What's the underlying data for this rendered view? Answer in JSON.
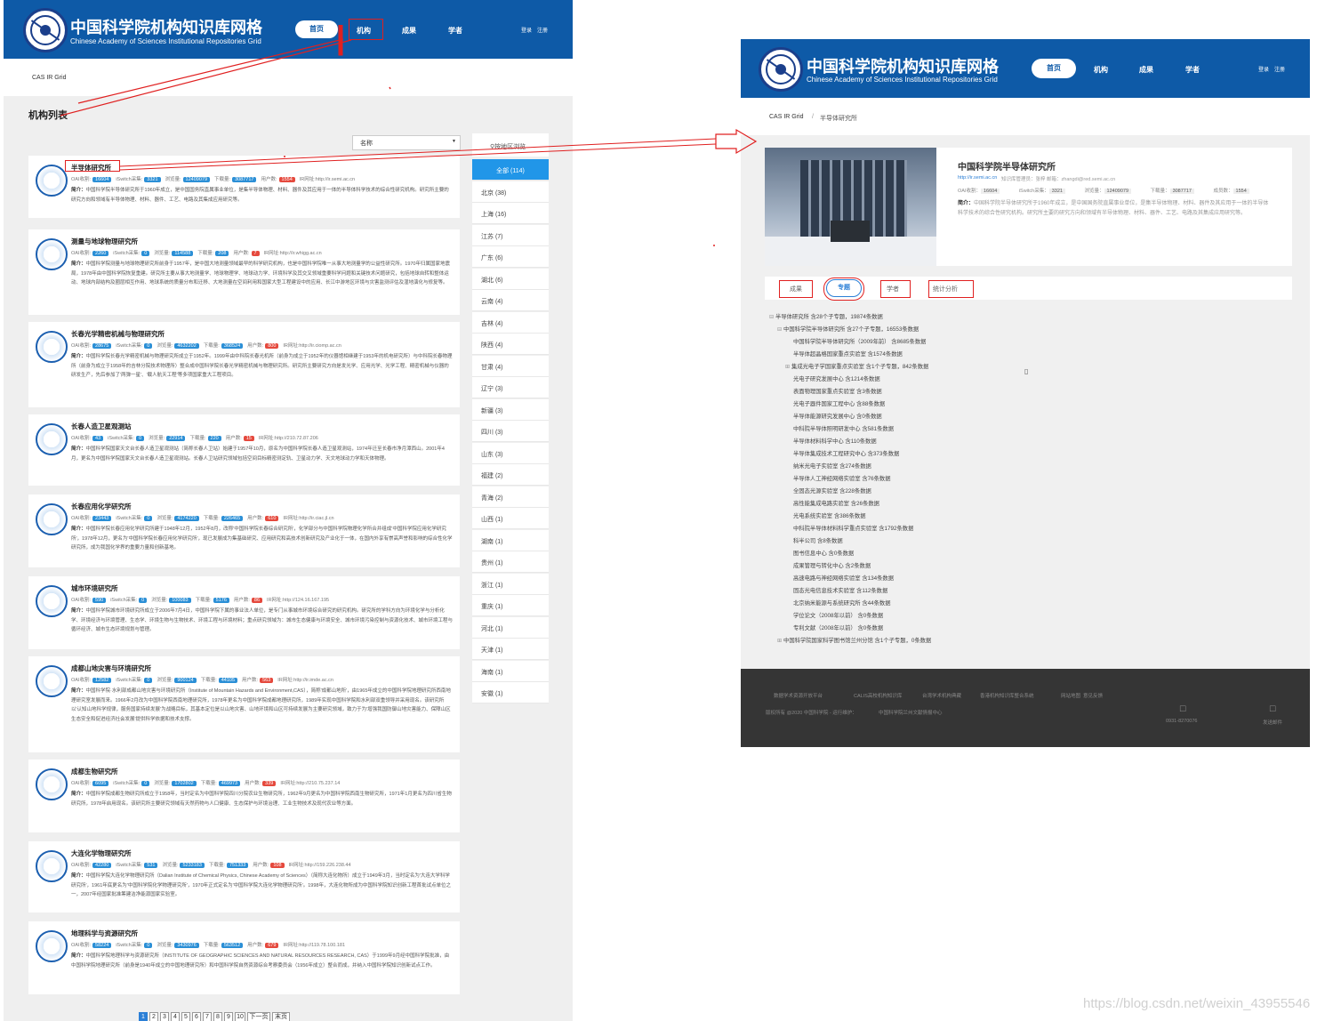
{
  "left": {
    "header": {
      "title": "中国科学院机构知识库网格",
      "subtitle": "Chinese Academy of Sciences Institutional Repositories Grid",
      "nav": [
        "首页",
        "机构",
        "成果",
        "学者"
      ],
      "login": "登录",
      "register": "注册"
    },
    "breadcrumb": "CAS IR Grid",
    "list_title": "机构列表",
    "sort_select": "名称",
    "region_title": "按地区浏览",
    "regions": [
      "全部 (114)",
      "北京 (38)",
      "上海 (16)",
      "江苏 (7)",
      "广东 (6)",
      "湖北 (6)",
      "云南 (4)",
      "吉林 (4)",
      "陕西 (4)",
      "甘肃 (4)",
      "辽宁 (3)",
      "新疆 (3)",
      "四川 (3)",
      "山东 (3)",
      "福建 (2)",
      "青海 (2)",
      "山西 (1)",
      "湖南 (1)",
      "贵州 (1)",
      "浙江 (1)",
      "重庆 (1)",
      "河北 (1)",
      "天津 (1)",
      "海南 (1)",
      "安徽 (1)"
    ],
    "stat_labels": {
      "oai": "OAI收割:",
      "iswitch": "iSwitch采集:",
      "views": "浏览量:",
      "downloads": "下载量:",
      "users": "用户数:",
      "url": "IR网址:",
      "intro": "简介："
    },
    "institutes": [
      {
        "name": "半导体研究所",
        "oai": "16604",
        "iswitch": "3321",
        "views": "12409079",
        "downloads": "3087717",
        "users": "1554",
        "url": "http://ir.semi.ac.cn",
        "intro": "中国科学院半导体研究所于1960年成立，是中国国务院直属事业单位，是集半导体物理、材料、器件及其应用于一体的半导体科学技术的综合性研究机构。研究所主要的研究方向和领域有半导体物理、材料、器件、工艺、电路及其集成应用研究等。"
      },
      {
        "name": "测量与地球物理研究所",
        "oai": "2260",
        "iswitch": "0",
        "views": "114588",
        "downloads": "208",
        "users": "7",
        "url": "http://ir.whigg.ac.cn",
        "intro": "中国科学院测量与地球物理研究所前身于1957年，是中国大地测量领域最早的科学研究机构，也是中国科学院唯一从事大地测量学的公益性研究所。1970年归属国家地震局，1978年由中国科学院恢复重建。研究所主要从事大地测量学、地球物理学、地球动力学、环境科学及其交叉领域重要科学问题和关键技术问题研究，包括地球自转和整体运动、地球内部结构及圈层相互作用、地球系统的质量分布和迁移、大地测量在空间利用和国家大型工程建设中的应用、长江中游地区环境与灾害监测评估及湿地演化与修复等。"
      },
      {
        "name": "长春光学精密机械与物理研究所",
        "oai": "28675",
        "iswitch": "0",
        "views": "4632202",
        "downloads": "368524",
        "users": "800",
        "url": "http://ir.ciomp.ac.cn",
        "intro": "中国科学院长春光学精密机械与物理研究所成立于1952年。1999年由中科院长春光机所（前身为成立于1952年的仪器馆相继建于1953年的机电研究所）与中科院长春物理所（前身为成立于1958年的吉林分院技术物理所）整合成中国科学院长春光学精密机械与物理研究所。研究所主要研究方向是发光学、应用光学、光学工程、精密机械与仪器的研发生产，先后参加了'两弹一星'、'载人航天工程'等多项国家重大工程项目。"
      },
      {
        "name": "长春人造卫星观测站",
        "oai": "43",
        "iswitch": "0",
        "views": "22914",
        "downloads": "220",
        "users": "15",
        "url": "http://210.72.87.206",
        "intro": "中国科学院国家天文台长春人造卫星观测站（简称长春人卫站）始建于1957年10月，原名为中国科学院长春人造卫星观测站，1974年迁至长春市净月潭西山。2001年4月，更名为中国科学院国家天文台长春人造卫星观测站。长春人卫站研究领域包括空间目标精密测定轨、卫星动力学、天文地球动力学和天体物理。"
      },
      {
        "name": "长春应用化学研究所",
        "oai": "23443",
        "iswitch": "0",
        "views": "4174220",
        "downloads": "226465",
        "users": "610",
        "url": "http://ir.ciac.jl.cn",
        "intro": "中国科学院长春应用化学研究所建于1948年12月，1952年8月，改称'中国科学院长春综合研究所'，化学部分与中国科学院物理化学所合并组成'中国科学院应用化学研究所'，1978年12月，更名为'中国科学院长春应用化学研究所'，现已发展成为集基础研究、应用研究和高技术创新研究及产业化于一体，在国内外享有崇高声誉和影响的综合性化学研究所，成为我国化学界的重要力量和创新基地。"
      },
      {
        "name": "城市环境研究所",
        "oai": "590",
        "iswitch": "0",
        "views": "100083",
        "downloads": "5176",
        "users": "86",
        "url": "http://124.16.167.195",
        "intro": "中国科学院城市环境研究所成立于2006年7月4日，中国科学院下属的事业法人单位，是专门从事城市环境综合研究的研究机构。研究所的学科方向为环境化学与分析化学、环境经济与环境管理、生态学、环境生物与生物技术、环境工程与环境材料；重点研究领域为：城市生态健康与环境安全、城市环境污染控制与资源化技术、城市环境工程与循环经济、城市生态环境规划与管理。"
      },
      {
        "name": "成都山地灾害与环境研究所",
        "oai": "12582",
        "iswitch": "0",
        "views": "900124",
        "downloads": "44105",
        "users": "563",
        "url": "http://ir.imde.ac.cn",
        "intro": "中国科学院·水利部成都山地灾害与环境研究所（Institute of Mountain Hazards and Environment,CAS），简称'成都山地所'，由1965年成立的中国科学院地理研究所西南地理研究室发展而来。1966年2月改为中国科学院西南地理研究所，1978年更名为中国科学院成都地理研究所，1989年实现中国科学院和水利部双重领导并采用现名。该研究所以'认知山地科学规律，服务国家持续发展'为战略目标，其基本定位是以山地灾害、山地环境和山区可持续发展为主要研究领域，致力于为'增强我国防御山地灾害能力、保障山区生态安全和促进经济社会发展'提供科学依据和技术支撑。"
      },
      {
        "name": "成都生物研究所",
        "oai": "6095",
        "iswitch": "0",
        "views": "1702802",
        "downloads": "469973",
        "users": "339",
        "url": "http://210.75.237.14",
        "intro": "中国科学院成都生物研究所成立于1958年，当时定名为中国科学院四川分院农业生物研究所，1962年9月更名为中国科学院西南生物研究所，1971年1月更名为四川省生物研究所，1978年启用现名。该研究所主要研究领域有天然药物与人口健康、生态保护与环境治理、工业生物技术及现代农业等方面。"
      },
      {
        "name": "大连化学物理研究所",
        "oai": "42280",
        "iswitch": "531",
        "views": "5233183",
        "downloads": "751333",
        "users": "108",
        "url": "http://159.226.238.44",
        "intro": "中国科学院大连化学物理研究所（Dalian Institute of Chemical Physics, Chinese Academy of Sciences）（简称大连化物所）成立于1949年3月，当时定名为'大连大学科学研究所'，1961年底更名为'中国科学院化学物理研究所'，1970年正式定名为'中国科学院大连化学物理研究所'。1998年，大连化物所成为中国科学院知识创新工程首批试点单位之一，2007年经国家批准筹建洁净能源国家实验室。"
      },
      {
        "name": "地理科学与资源研究所",
        "oai": "58224",
        "iswitch": "0",
        "views": "3430976",
        "downloads": "563512",
        "users": "679",
        "url": "http://119.78.100.181",
        "intro": "中国科学院地理科学与资源研究所（INSTITUTE OF GEOGRAPHIC SCIENCES AND NATURAL RESOURCES RESEARCH, CAS）于1999年9月经中国科学院批准，由中国科学院地理研究所（前身是1940年成立的中国地理研究所）和中国科学院自然资源综合考察委员会（1956年成立）整合而成，并纳入中国科学院知识创新试点工作。"
      }
    ],
    "pagination": [
      "1",
      "2",
      "3",
      "4",
      "5",
      "6",
      "7",
      "8",
      "9",
      "10",
      "下一页",
      "末页"
    ]
  },
  "right": {
    "header": {
      "title": "中国科学院机构知识库网格",
      "subtitle": "Chinese Academy of Sciences Institutional Repositories Grid",
      "nav": [
        "首页",
        "机构",
        "成果",
        "学者"
      ],
      "login": "登录",
      "register": "注册"
    },
    "breadcrumb": [
      "CAS IR Grid",
      "/",
      "半导体研究所"
    ],
    "detail": {
      "name": "中国科学院半导体研究所",
      "url": "http://ir.semi.ac.cn",
      "admin": "知识库管理员：张梓  邮箱：zhangdi@red.semi.ac.cn",
      "stats": [
        "OAI收割：",
        "16604",
        "iSwitch采集：",
        "3321",
        "浏览量：",
        "12409079",
        "下载量：",
        "3087717",
        "成员数：",
        "1554"
      ],
      "intro_label": "简介：",
      "intro": "中国科学院半导体研究所于1960年成立，是中国国务院直属事业单位，是集半导体物理、材料、器件及其应用于一体的半导体科学技术的综合性研究机构。研究所主要的研究方向和领域有半导体物理、材料、器件、工艺、电路及其集成应用研究等。"
    },
    "tabs": [
      "成果",
      "专题",
      "学者",
      "统计分析"
    ],
    "tree": [
      {
        "indent": 0,
        "mark": "⊟",
        "label": "半导体研究所",
        "count": "含28个子专题，19874条数据"
      },
      {
        "indent": 1,
        "mark": "⊟",
        "label": "中国科学院半导体研究所",
        "count": "含27个子专题，16553条数据"
      },
      {
        "indent": 2,
        "mark": "",
        "label": "中国科学院半导体研究所（2009年前）",
        "count": "含8685条数据"
      },
      {
        "indent": 2,
        "mark": "",
        "label": "半导体超晶格国家重点实验室",
        "count": "含1574条数据"
      },
      {
        "indent": 2,
        "mark": "⊞",
        "label": "集成光电子学国家重点实验室",
        "count": "含1个子专题，842条数据"
      },
      {
        "indent": 2,
        "mark": "",
        "label": "光电子研究发展中心",
        "count": "含1214条数据"
      },
      {
        "indent": 2,
        "mark": "",
        "label": "表面物理国家重点实验室",
        "count": "含3条数据"
      },
      {
        "indent": 2,
        "mark": "",
        "label": "光电子器件国家工程中心",
        "count": "含88条数据"
      },
      {
        "indent": 2,
        "mark": "",
        "label": "半导体能源研究发展中心",
        "count": "含0条数据"
      },
      {
        "indent": 2,
        "mark": "",
        "label": "中科院半导体照明研发中心",
        "count": "含581条数据"
      },
      {
        "indent": 2,
        "mark": "",
        "label": "半导体材料科学中心",
        "count": "含110条数据"
      },
      {
        "indent": 2,
        "mark": "",
        "label": "半导体集成技术工程研究中心",
        "count": "含373条数据"
      },
      {
        "indent": 2,
        "mark": "",
        "label": "纳米光电子实验室",
        "count": "含274条数据"
      },
      {
        "indent": 2,
        "mark": "",
        "label": "半导体人工神经网络实验室",
        "count": "含76条数据"
      },
      {
        "indent": 2,
        "mark": "",
        "label": "全固态光源实验室",
        "count": "含228条数据"
      },
      {
        "indent": 2,
        "mark": "",
        "label": "高性能集成电路实验室",
        "count": "含26条数据"
      },
      {
        "indent": 2,
        "mark": "",
        "label": "光电系统实验室",
        "count": "含386条数据"
      },
      {
        "indent": 2,
        "mark": "",
        "label": "中科院半导体材料科学重点实验室",
        "count": "含1792条数据"
      },
      {
        "indent": 2,
        "mark": "",
        "label": "科半公司",
        "count": "含8条数据"
      },
      {
        "indent": 2,
        "mark": "",
        "label": "图书信息中心",
        "count": "含0条数据"
      },
      {
        "indent": 2,
        "mark": "",
        "label": "成果管理与转化中心",
        "count": "含2条数据"
      },
      {
        "indent": 2,
        "mark": "",
        "label": "高速电路与神经网络实验室",
        "count": "含134条数据"
      },
      {
        "indent": 2,
        "mark": "",
        "label": "固态光电信息技术实验室",
        "count": "含112条数据"
      },
      {
        "indent": 2,
        "mark": "",
        "label": "北京纳米能源与系统研究所",
        "count": "含44条数据"
      },
      {
        "indent": 2,
        "mark": "",
        "label": "学位论文（2008年以前）",
        "count": "含0条数据"
      },
      {
        "indent": 2,
        "mark": "",
        "label": "专利文献（2008年以前）",
        "count": "含0条数据"
      },
      {
        "indent": 1,
        "mark": "⊞",
        "label": "中国科学院国家科学图书馆兰州分馆",
        "count": "含1个子专题，0条数据"
      }
    ],
    "footer": {
      "links": [
        "数据学术资源开放平台",
        "CALIS高校机构知识库",
        "台湾学术机构典藏",
        "香港机构知识库整合系统",
        "网站地图",
        "意见反馈"
      ],
      "copyright": "版权所有 @2020 中国科学院 - 运行维护：",
      "maintainer": "中国科学院兰州文献情报中心",
      "phone": "0931-8270076",
      "mail": "发送邮件"
    }
  },
  "watermark": "https://blog.csdn.net/weixin_43955546"
}
